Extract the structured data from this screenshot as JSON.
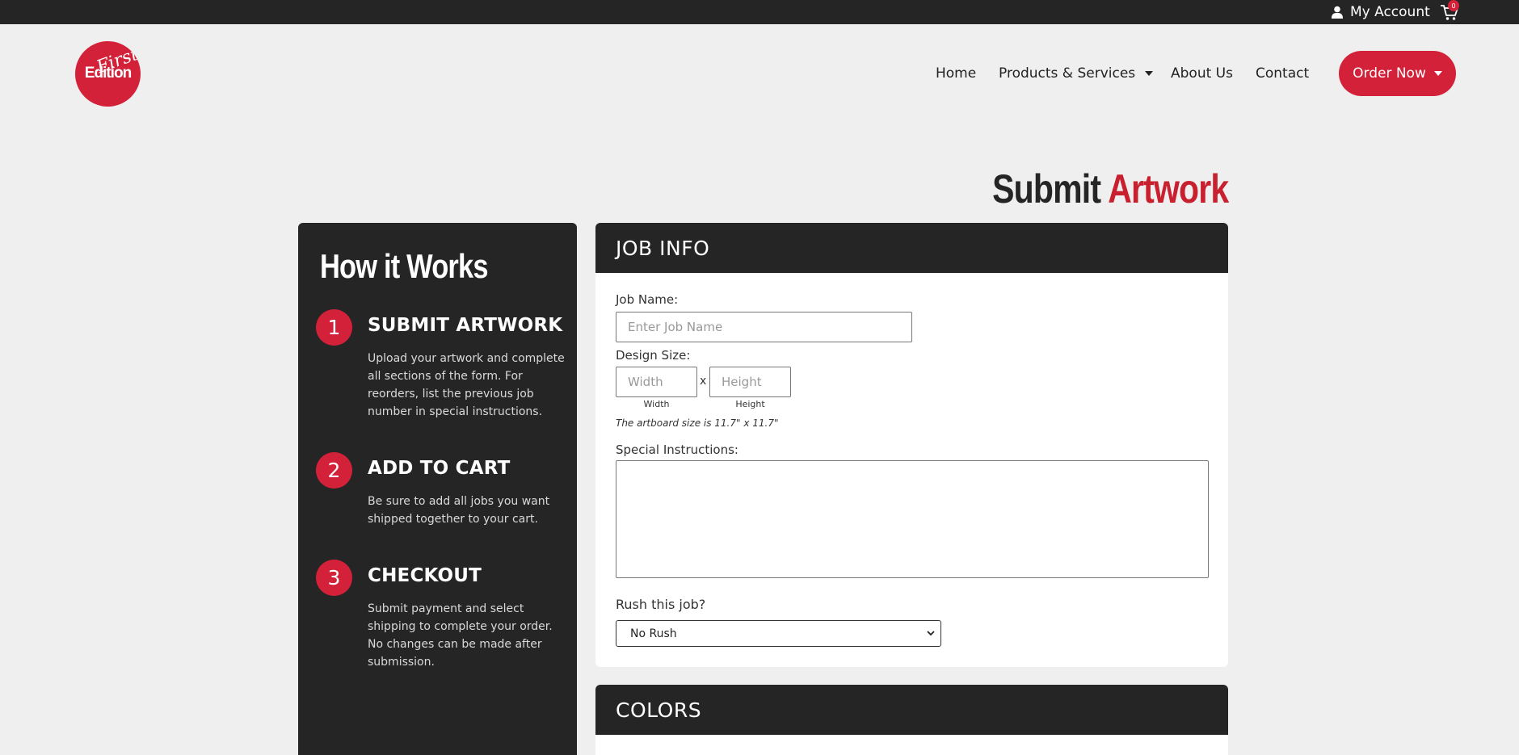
{
  "topbar": {
    "account_label": "My Account",
    "cart_count": "0",
    "account_icon": "user-icon",
    "cart_icon": "cart-icon"
  },
  "brand": {
    "name": "Edition",
    "script": "First",
    "color": "#d4213a"
  },
  "nav": {
    "items": [
      {
        "label": "Home"
      },
      {
        "label": "Products & Services",
        "has_dropdown": true
      },
      {
        "label": "About Us"
      },
      {
        "label": "Contact"
      }
    ],
    "order_button": "Order Now"
  },
  "page": {
    "title_part1": "Submit",
    "title_part2": "Artwork"
  },
  "how": {
    "title": "How it Works",
    "steps": [
      {
        "num": "1",
        "title": "SUBMIT ARTWORK",
        "desc": "Upload your artwork and complete all sections of the form.  For reorders, list the previous job number in special instructions."
      },
      {
        "num": "2",
        "title": "ADD TO CART",
        "desc": "Be sure to add all jobs you want shipped together to your cart."
      },
      {
        "num": "3",
        "title": "CHECKOUT",
        "desc": "Submit payment and select shipping to complete your order. No changes can be made after submission."
      }
    ]
  },
  "job_info": {
    "header": "JOB INFO",
    "job_name_label": "Job Name:",
    "job_name_placeholder": "Enter Job Name",
    "design_size_label": "Design Size:",
    "width_placeholder": "Width",
    "height_placeholder": "Height",
    "times": "x",
    "width_sub": "Width",
    "height_sub": "Height",
    "artboard_note": "The artboard size is 11.7\" x 11.7\"",
    "special_label": "Special Instructions:",
    "special_value": "",
    "rush_label": "Rush this job?",
    "rush_selected": "No Rush"
  },
  "colors": {
    "header": "COLORS"
  }
}
